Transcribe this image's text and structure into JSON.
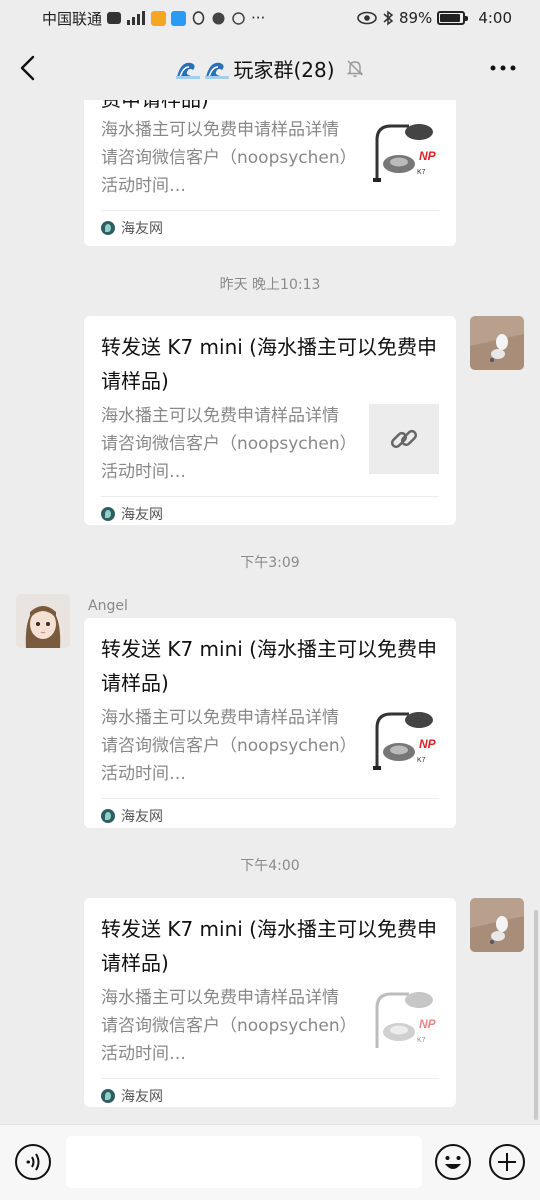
{
  "status": {
    "carrier": "中国联通",
    "battery": "89%",
    "time": "4:00",
    "more": "···"
  },
  "nav": {
    "title": "玩家群(28)"
  },
  "messages": [
    {
      "title": "费申请样品)",
      "desc": "海水播主可以免费申请样品详情请咨询微信客户（noopsychen）活动时间…",
      "source": "海友网"
    },
    {
      "time": "昨天 晚上10:13",
      "title": "转发送 K7 mini (海水播主可以免费申请样品)",
      "desc": "海水播主可以免费申请样品详情请咨询微信客户（noopsychen）活动时间…",
      "source": "海友网"
    },
    {
      "time": "下午3:09",
      "sender": "Angel",
      "title": "转发送 K7 mini (海水播主可以免费申请样品)",
      "desc": "海水播主可以免费申请样品详情请咨询微信客户（noopsychen）活动时间…",
      "source": "海友网"
    },
    {
      "time": "下午4:00",
      "title": "转发送 K7 mini (海水播主可以免费申请样品)",
      "desc": "海水播主可以免费申请样品详情请咨询微信客户（noopsychen）活动时间…",
      "source": "海友网"
    }
  ],
  "thumb": {
    "brand": "NP",
    "model": "K7"
  },
  "input": {
    "value": ""
  },
  "icons": {
    "back": "chevron-left-icon",
    "mute": "bell-off-icon",
    "more": "more-dots-icon",
    "voice": "voice-icon",
    "emoji": "emoji-icon",
    "plus": "plus-icon",
    "link": "link-icon"
  },
  "colors": {
    "background": "#ededed",
    "card": "#ffffff",
    "brand_red": "#e02020"
  }
}
